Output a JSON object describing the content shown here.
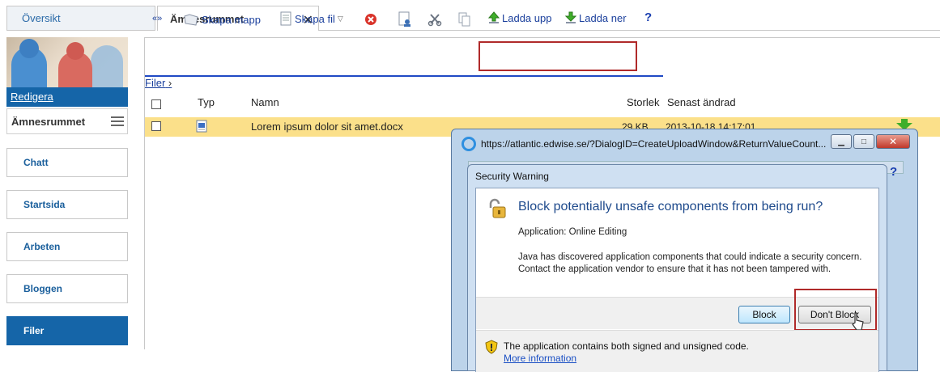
{
  "tabs": {
    "overview_label": "Översikt",
    "active_label": "Ämnesrummet",
    "close_glyph": "✕"
  },
  "sidebar": {
    "edit_link": "Redigera",
    "room_title": "Ämnesrummet",
    "nav": [
      {
        "label": "Chatt",
        "active": false
      },
      {
        "label": "Startsida",
        "active": false
      },
      {
        "label": "Arbeten",
        "active": false
      },
      {
        "label": "Bloggen",
        "active": false
      },
      {
        "label": "Filer",
        "active": true
      }
    ]
  },
  "toolbar": {
    "collapse_glyph": "«»",
    "create_folder": "Skapa mapp",
    "create_file": "Skapa fil",
    "upload": "Ladda upp",
    "download": "Ladda ner",
    "help": "?"
  },
  "breadcrumb": {
    "label": "Filer",
    "separator": "›"
  },
  "table": {
    "headers": {
      "type": "Typ",
      "name": "Namn",
      "size": "Storlek",
      "modified": "Senast ändrad"
    },
    "rows": [
      {
        "name": "Lorem ipsum dolor sit amet.docx",
        "size": "29 KB",
        "modified": "2013-10-18 14:17:01",
        "icon": "word-doc-icon"
      }
    ]
  },
  "browser_window": {
    "title": "https://atlantic.edwise.se/?DialogID=CreateUploadWindow&ReturnValueCount...",
    "help": "?"
  },
  "security_dialog": {
    "title": "Security Warning",
    "heading": "Block potentially unsafe components from being run?",
    "application": "Application: Online Editing",
    "description": "Java has discovered application components that could indicate a security concern. Contact the application vendor to ensure that it has not been tampered with.",
    "block_button": "Block",
    "dont_block_button": "Don't Block",
    "footer_text": "The application contains both signed and unsigned code.",
    "footer_link": "More information"
  },
  "colors": {
    "accent": "#1565a8",
    "highlight_row": "#fbe08a",
    "callout_border": "#b02a2a",
    "link": "#1a3f9c"
  }
}
